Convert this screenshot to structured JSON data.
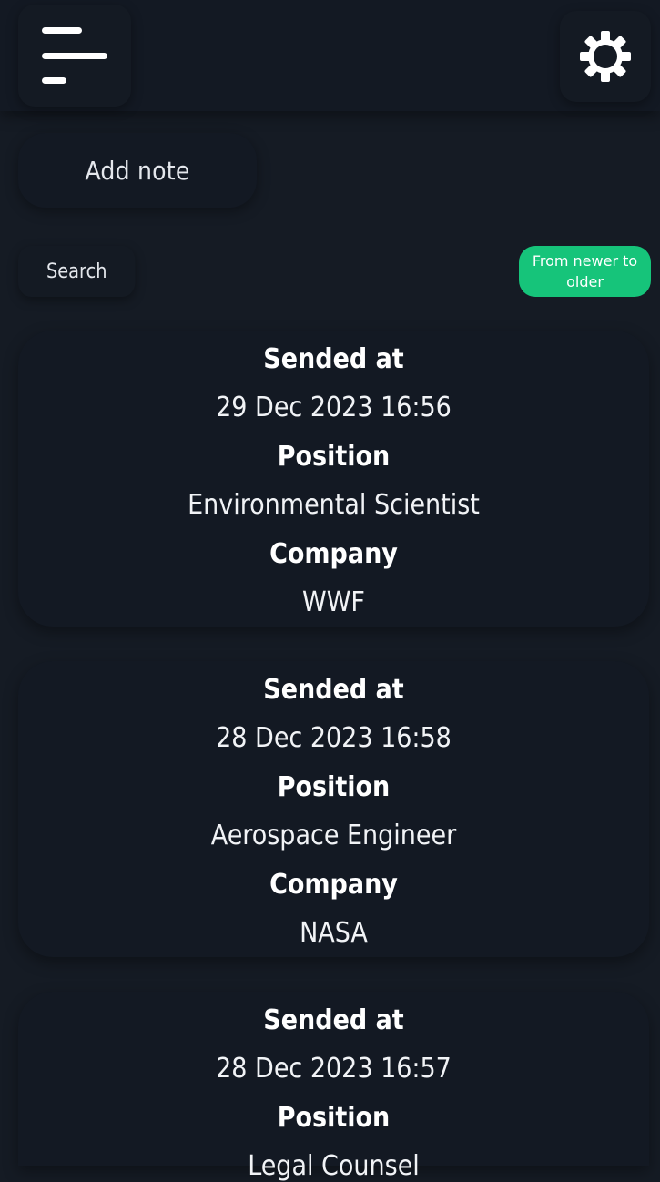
{
  "header": {
    "menu_icon": "hamburger-menu-icon",
    "settings_icon": "gear-icon"
  },
  "actions": {
    "add_note_label": "Add note",
    "search_label": "Search",
    "sort_label": "From newer to older",
    "sort_color": "#16c47a"
  },
  "labels": {
    "sended_at": "Sended at",
    "position": "Position",
    "company": "Company"
  },
  "notes": [
    {
      "sended_at": "29 Dec 2023 16:56",
      "position": "Environmental Scientist",
      "company": "WWF"
    },
    {
      "sended_at": "28 Dec 2023 16:58",
      "position": "Aerospace Engineer",
      "company": "NASA"
    },
    {
      "sended_at": "28 Dec 2023 16:57",
      "position": "Legal Counsel",
      "company": ""
    }
  ]
}
